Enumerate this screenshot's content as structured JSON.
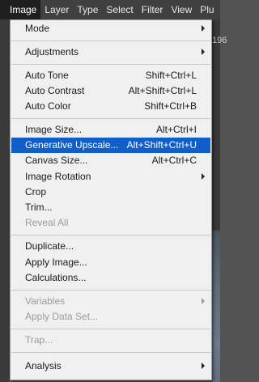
{
  "menubar": {
    "items": [
      "Image",
      "Layer",
      "Type",
      "Select",
      "Filter",
      "View",
      "Plu"
    ],
    "active_index": 0
  },
  "workspace": {
    "right_tab_fragment": "196"
  },
  "image_menu": {
    "mode": {
      "label": "Mode"
    },
    "adjustments": {
      "label": "Adjustments"
    },
    "auto_tone": {
      "label": "Auto Tone",
      "shortcut": "Shift+Ctrl+L"
    },
    "auto_contrast": {
      "label": "Auto Contrast",
      "shortcut": "Alt+Shift+Ctrl+L"
    },
    "auto_color": {
      "label": "Auto Color",
      "shortcut": "Shift+Ctrl+B"
    },
    "image_size": {
      "label": "Image Size...",
      "shortcut": "Alt+Ctrl+I"
    },
    "generative_upscale": {
      "label": "Generative Upscale...",
      "shortcut": "Alt+Shift+Ctrl+U"
    },
    "canvas_size": {
      "label": "Canvas Size...",
      "shortcut": "Alt+Ctrl+C"
    },
    "image_rotation": {
      "label": "Image Rotation"
    },
    "crop": {
      "label": "Crop"
    },
    "trim": {
      "label": "Trim..."
    },
    "reveal_all": {
      "label": "Reveal All"
    },
    "duplicate": {
      "label": "Duplicate..."
    },
    "apply_image": {
      "label": "Apply Image..."
    },
    "calculations": {
      "label": "Calculations..."
    },
    "variables": {
      "label": "Variables"
    },
    "apply_data_set": {
      "label": "Apply Data Set..."
    },
    "trap": {
      "label": "Trap..."
    },
    "analysis": {
      "label": "Analysis"
    }
  },
  "colors": {
    "highlight": "#0f5ec9",
    "menu_bg": "#f0f0f0",
    "menubar_bg": "#404040",
    "disabled_text": "#9b9b9b"
  }
}
